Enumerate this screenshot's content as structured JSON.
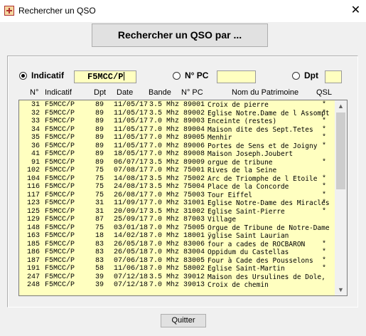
{
  "window": {
    "title": "Rechercher un QSO",
    "close_glyph": "✕",
    "icon": "app-icon"
  },
  "search_button": {
    "label": "Rechercher un QSO par ..."
  },
  "filters": {
    "indicatif": {
      "label": "Indicatif",
      "value": "F5MCC/P",
      "checked": true
    },
    "npc": {
      "label": "N° PC",
      "value": "",
      "checked": false
    },
    "dpt": {
      "label": "Dpt",
      "value": "",
      "checked": false
    }
  },
  "columns": {
    "num": "N°",
    "indicatif": "Indicatif",
    "dpt": "Dpt",
    "date": "Date",
    "bande": "Bande",
    "npc": "N° PC",
    "nom": "Nom du Patrimoine",
    "qsl": "QSL"
  },
  "rows": [
    {
      "num": "31",
      "ind": "F5MCC/P",
      "dpt": "89",
      "date": "11/05/17",
      "bande": "3.5 Mhz",
      "npc": "89001",
      "nom": "Croix de pierre",
      "qsl": "*"
    },
    {
      "num": "32",
      "ind": "F5MCC/P",
      "dpt": "89",
      "date": "11/05/17",
      "bande": "3.5 Mhz",
      "npc": "89002",
      "nom": "Eglise Notre.Dame de l Assompt",
      "qsl": "*"
    },
    {
      "num": "33",
      "ind": "F5MCC/P",
      "dpt": "89",
      "date": "11/05/17",
      "bande": "7.0 Mhz",
      "npc": "89003",
      "nom": "Enceinte (restes)",
      "qsl": "*"
    },
    {
      "num": "34",
      "ind": "F5MCC/P",
      "dpt": "89",
      "date": "11/05/17",
      "bande": "7.0 Mhz",
      "npc": "89004",
      "nom": "Maison dite des Sept.Tetes",
      "qsl": "*"
    },
    {
      "num": "35",
      "ind": "F5MCC/P",
      "dpt": "89",
      "date": "11/05/17",
      "bande": "7.0 Mhz",
      "npc": "89005",
      "nom": "Menhir",
      "qsl": "*"
    },
    {
      "num": "36",
      "ind": "F5MCC/P",
      "dpt": "89",
      "date": "11/05/17",
      "bande": "7.0 Mhz",
      "npc": "89006",
      "nom": "Portes de Sens et de Joigny",
      "qsl": "*"
    },
    {
      "num": "41",
      "ind": "F5MCC/P",
      "dpt": "89",
      "date": "18/05/17",
      "bande": "7.0 Mhz",
      "npc": "89008",
      "nom": "Maison Joseph.Joubert",
      "qsl": ""
    },
    {
      "num": "91",
      "ind": "F5MCC/P",
      "dpt": "89",
      "date": "06/07/17",
      "bande": "3.5 Mhz",
      "npc": "89009",
      "nom": "orgue de tribune",
      "qsl": "*"
    },
    {
      "num": "102",
      "ind": "F5MCC/P",
      "dpt": "75",
      "date": "07/08/17",
      "bande": "7.0 Mhz",
      "npc": "75001",
      "nom": "Rives de la Seine",
      "qsl": ""
    },
    {
      "num": "104",
      "ind": "F5MCC/P",
      "dpt": "75",
      "date": "14/08/17",
      "bande": "3.5 Mhz",
      "npc": "75002",
      "nom": "Arc de Triomphe de l Etoile",
      "qsl": "*"
    },
    {
      "num": "116",
      "ind": "F5MCC/P",
      "dpt": "75",
      "date": "24/08/17",
      "bande": "3.5 Mhz",
      "npc": "75004",
      "nom": "Place de la Concorde",
      "qsl": "*"
    },
    {
      "num": "117",
      "ind": "F5MCC/P",
      "dpt": "75",
      "date": "26/08/17",
      "bande": "7.0 Mhz",
      "npc": "75003",
      "nom": "Tour Eiffel",
      "qsl": "*"
    },
    {
      "num": "123",
      "ind": "F5MCC/P",
      "dpt": "31",
      "date": "11/09/17",
      "bande": "7.0 Mhz",
      "npc": "31001",
      "nom": "Eglise Notre-Dame des Miracles",
      "qsl": "*"
    },
    {
      "num": "125",
      "ind": "F5MCC/P",
      "dpt": "31",
      "date": "20/09/17",
      "bande": "3.5 Mhz",
      "npc": "31002",
      "nom": "Eglise Saint-Pierre",
      "qsl": "*"
    },
    {
      "num": "129",
      "ind": "F5MCC/P",
      "dpt": "87",
      "date": "25/09/17",
      "bande": "7.0 Mhz",
      "npc": "87003",
      "nom": "Village",
      "qsl": ""
    },
    {
      "num": "148",
      "ind": "F5MCC/P",
      "dpt": "75",
      "date": "03/01/18",
      "bande": "7.0 Mhz",
      "npc": "75005",
      "nom": "Orgue de Tribune de Notre-Dame",
      "qsl": ""
    },
    {
      "num": "163",
      "ind": "F5MCC/P",
      "dpt": "18",
      "date": "14/02/18",
      "bande": "7.0 Mhz",
      "npc": "18001",
      "nom": "ÿglise Saint Laurian",
      "qsl": ""
    },
    {
      "num": "185",
      "ind": "F5MCC/P",
      "dpt": "83",
      "date": "26/05/18",
      "bande": "7.0 Mhz",
      "npc": "83006",
      "nom": "four a cades de ROCBARON",
      "qsl": "*"
    },
    {
      "num": "186",
      "ind": "F5MCC/P",
      "dpt": "83",
      "date": "26/05/18",
      "bande": "7.0 Mhz",
      "npc": "83004",
      "nom": "Oppidum du Castellas",
      "qsl": "*"
    },
    {
      "num": "187",
      "ind": "F5MCC/P",
      "dpt": "83",
      "date": "07/06/18",
      "bande": "7.0 Mhz",
      "npc": "83005",
      "nom": "Four à Cade des Pousselons",
      "qsl": "*"
    },
    {
      "num": "191",
      "ind": "F5MCC/P",
      "dpt": "58",
      "date": "11/06/18",
      "bande": "7.0 Mhz",
      "npc": "58002",
      "nom": "Eglise Saint-Martin",
      "qsl": "*"
    },
    {
      "num": "247",
      "ind": "F5MCC/P",
      "dpt": "39",
      "date": "07/12/18",
      "bande": "3.5 Mhz",
      "npc": "39012",
      "nom": "Maison des Ursulines de Dole,",
      "qsl": ""
    },
    {
      "num": "248",
      "ind": "F5MCC/P",
      "dpt": "39",
      "date": "07/12/18",
      "bande": "7.0 Mhz",
      "npc": "39013",
      "nom": "Croix de chemin",
      "qsl": ""
    }
  ],
  "scrollbar": {
    "up_glyph": "▲",
    "down_glyph": "▼"
  },
  "quit_button": {
    "label": "Quitter"
  }
}
